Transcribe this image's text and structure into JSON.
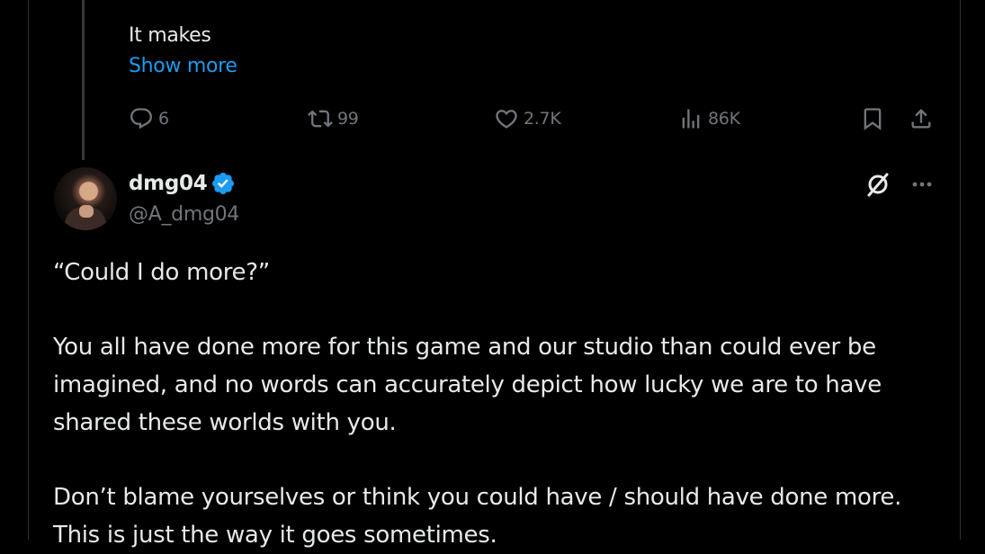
{
  "previous_tweet": {
    "text": "It makes",
    "show_more": "Show more",
    "actions": {
      "replies": "6",
      "reposts": "99",
      "likes": "2.7K",
      "views": "86K"
    }
  },
  "tweet": {
    "display_name": "dmg04",
    "handle": "@A_dmg04",
    "verified": true,
    "lines": [
      "“Could I do more?”",
      "You all have done more for this game and our studio than could ever be",
      "imagined, and no words can accurately depict how lucky we are to have",
      "shared these worlds with you.",
      "Don’t blame yourselves or think you could have / should have done more.",
      "This is just the way it goes sometimes."
    ]
  },
  "colors": {
    "background": "#000000",
    "text": "#e7e9ea",
    "muted": "#71767b",
    "accent": "#1d9bf0",
    "border": "#2f3336"
  },
  "icons": [
    "reply-icon",
    "repost-icon",
    "like-icon",
    "views-icon",
    "bookmark-icon",
    "share-icon",
    "verified-badge-icon",
    "grok-icon",
    "more-icon"
  ]
}
